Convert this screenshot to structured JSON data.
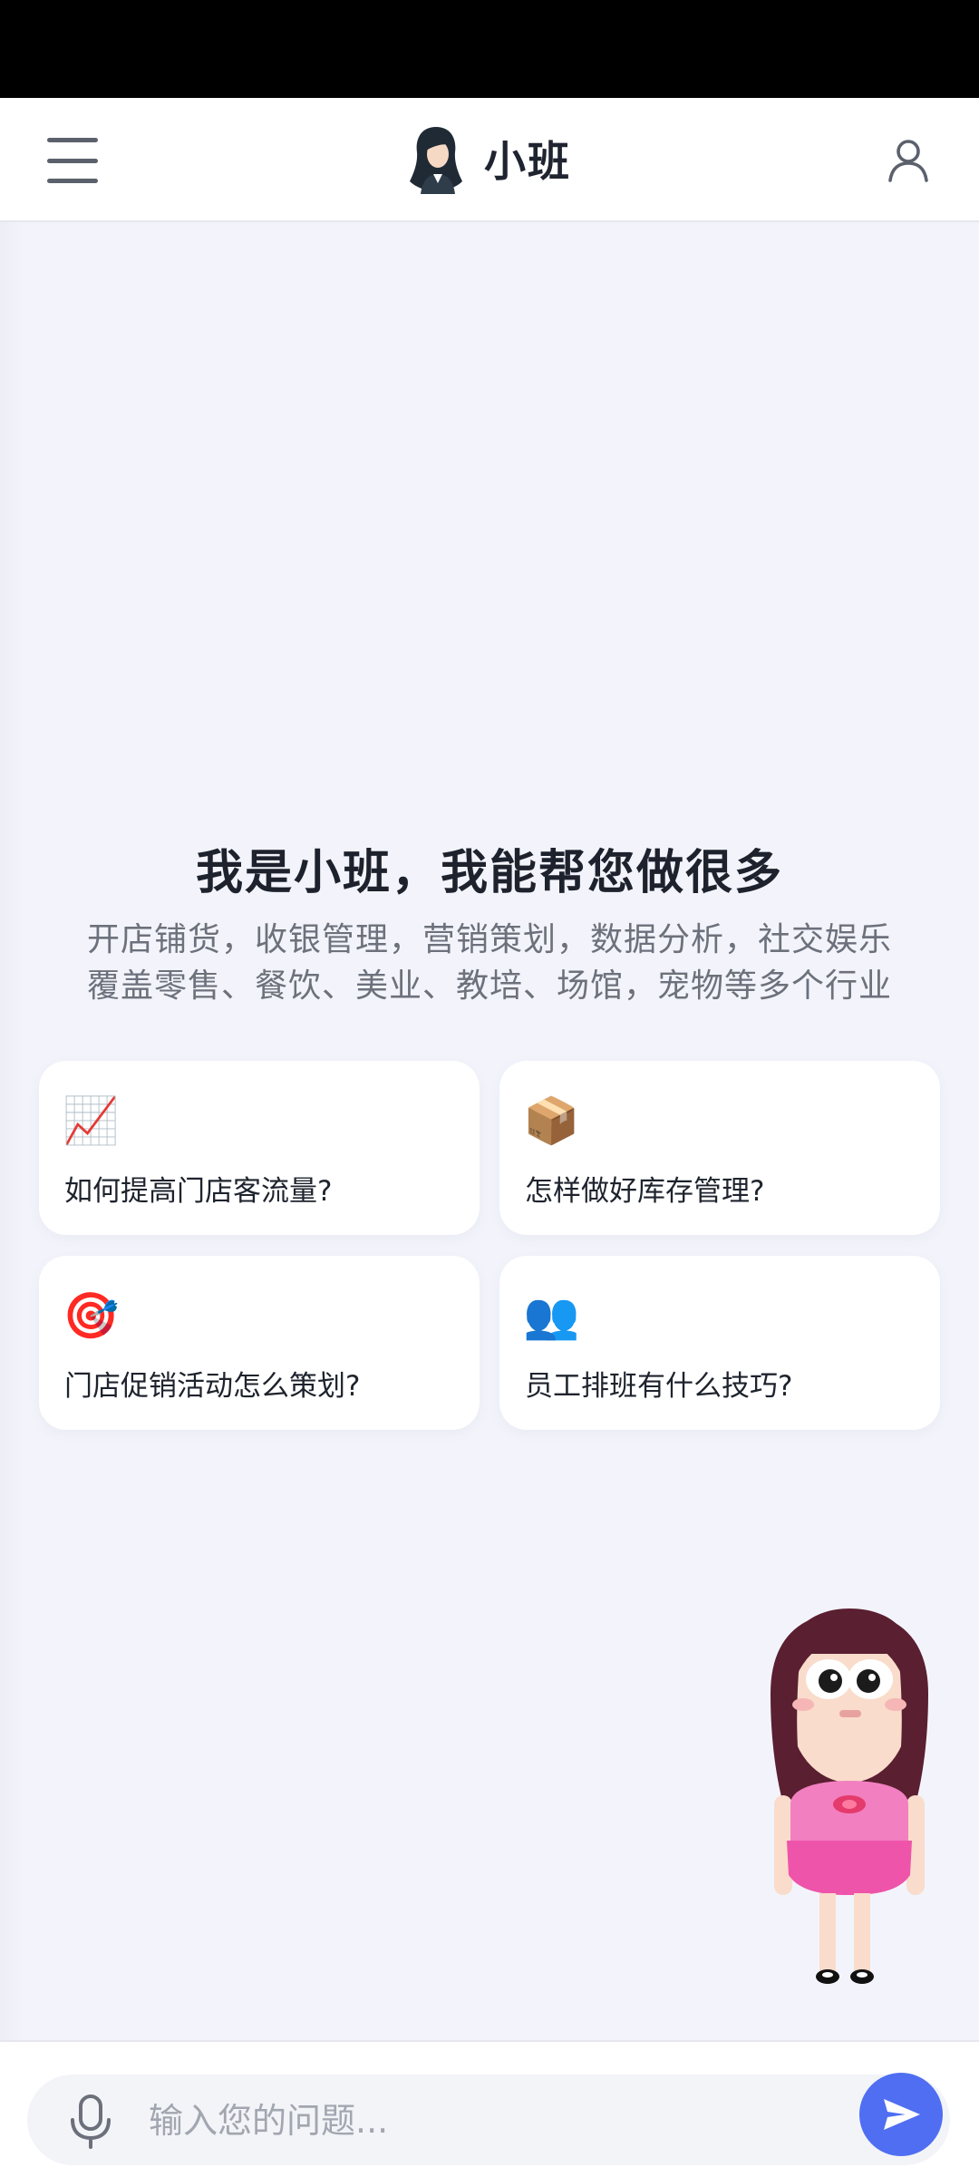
{
  "header": {
    "title": "小班",
    "menu_icon": "hamburger-menu-icon",
    "user_icon": "user-profile-icon",
    "logo_icon": "assistant-avatar-logo"
  },
  "hero": {
    "title": "我是小班，我能帮您做很多",
    "subtitle_line1": "开店铺货，收银管理，营销策划，数据分析，社交娱乐",
    "subtitle_line2": "覆盖零售、餐饮、美业、教培、场馆，宠物等多个行业"
  },
  "suggestions": [
    {
      "icon": "📈",
      "icon_name": "chart-increasing-icon",
      "label": "如何提高门店客流量?"
    },
    {
      "icon": "📦",
      "icon_name": "package-box-icon",
      "label": "怎样做好库存管理?"
    },
    {
      "icon": "🎯",
      "icon_name": "target-dart-icon",
      "label": "门店促销活动怎么策划?"
    },
    {
      "icon": "👥",
      "icon_name": "people-group-icon",
      "label": "员工排班有什么技巧?"
    }
  ],
  "composer": {
    "placeholder": "输入您的问题...",
    "value": "",
    "mic_icon": "microphone-icon",
    "send_icon": "send-arrow-icon"
  },
  "colors": {
    "accent": "#4f6ef2",
    "background": "#f3f4fb",
    "card": "#ffffff",
    "title_text": "#1d222d",
    "subtitle_text": "#6c717c"
  }
}
